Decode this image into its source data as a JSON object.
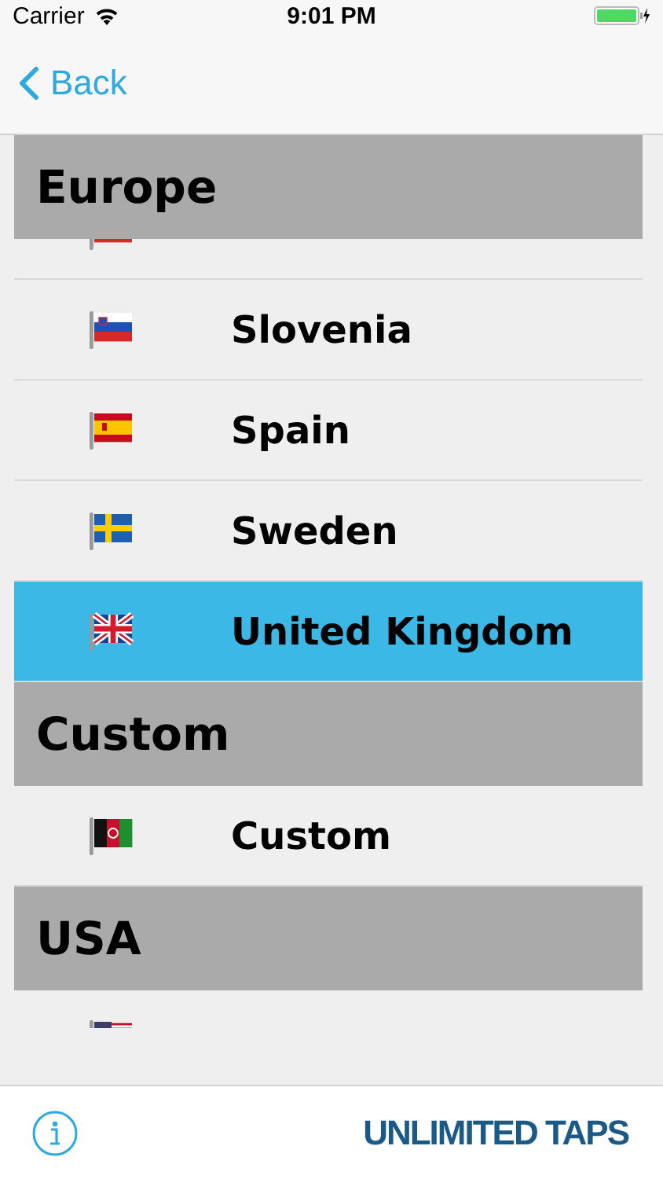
{
  "status_bar": {
    "carrier": "Carrier",
    "time": "9:01 PM"
  },
  "nav": {
    "back": "Back"
  },
  "sections": [
    {
      "title": "Europe",
      "rows": [
        {
          "kind": "tail",
          "flag": {
            "kind": "sk"
          },
          "selected": false
        },
        {
          "kind": "full",
          "flag": {
            "kind": "si"
          },
          "name": "Slovenia",
          "selected": false
        },
        {
          "kind": "full",
          "flag": {
            "kind": "es"
          },
          "name": "Spain",
          "selected": false
        },
        {
          "kind": "full",
          "flag": {
            "kind": "se"
          },
          "name": "Sweden",
          "selected": false
        },
        {
          "kind": "full",
          "flag": {
            "kind": "gb"
          },
          "name": "United Kingdom",
          "selected": true
        }
      ]
    },
    {
      "title": "Custom",
      "rows": [
        {
          "kind": "full",
          "flag": {
            "kind": "af"
          },
          "name": "Custom",
          "selected": false
        }
      ]
    },
    {
      "title": "USA",
      "rows": [
        {
          "kind": "head",
          "flag": {
            "kind": "us"
          },
          "selected": false
        }
      ]
    }
  ],
  "footer": {
    "brand": "UNLIMITED TAPS"
  }
}
